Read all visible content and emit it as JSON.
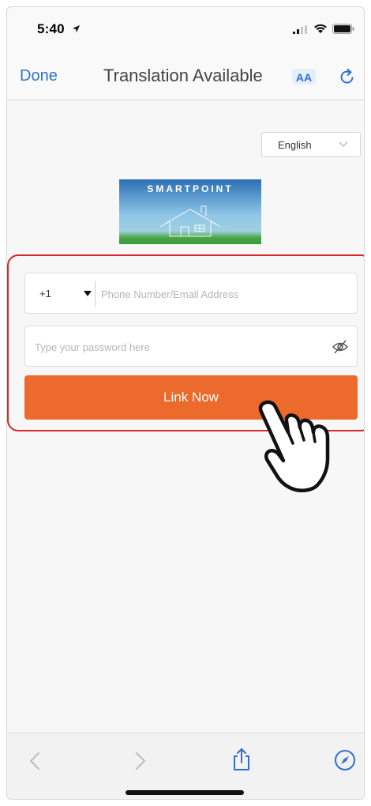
{
  "status_bar": {
    "time": "5:40",
    "icons": [
      "location-arrow-icon",
      "cellular-signal-icon",
      "wifi-icon",
      "battery-icon"
    ]
  },
  "nav_bar": {
    "done_label": "Done",
    "title": "Translation Available",
    "aa_label": "AA",
    "icons": [
      "translate-aa-icon",
      "reload-icon"
    ],
    "accent_color": "#2f6fd6"
  },
  "language_selector": {
    "selected": "English",
    "icon": "chevron-down-icon"
  },
  "logo": {
    "text": "SMARTPOINT",
    "icon": "house-logo"
  },
  "login_form": {
    "country_code": "+1",
    "phone_placeholder": "Phone Number/Email Address",
    "password_placeholder": "Type your password here",
    "password_toggle_icon": "eye-slash-icon",
    "submit_label": "Link Now",
    "submit_color": "#ec6a2c",
    "highlight_color": "#d22a2a"
  },
  "overlay": {
    "icon": "pointing-hand-cursor-icon"
  },
  "toolbar": {
    "icons": [
      "back-chevron-icon",
      "forward-chevron-icon",
      "share-icon",
      "compass-icon"
    ]
  }
}
